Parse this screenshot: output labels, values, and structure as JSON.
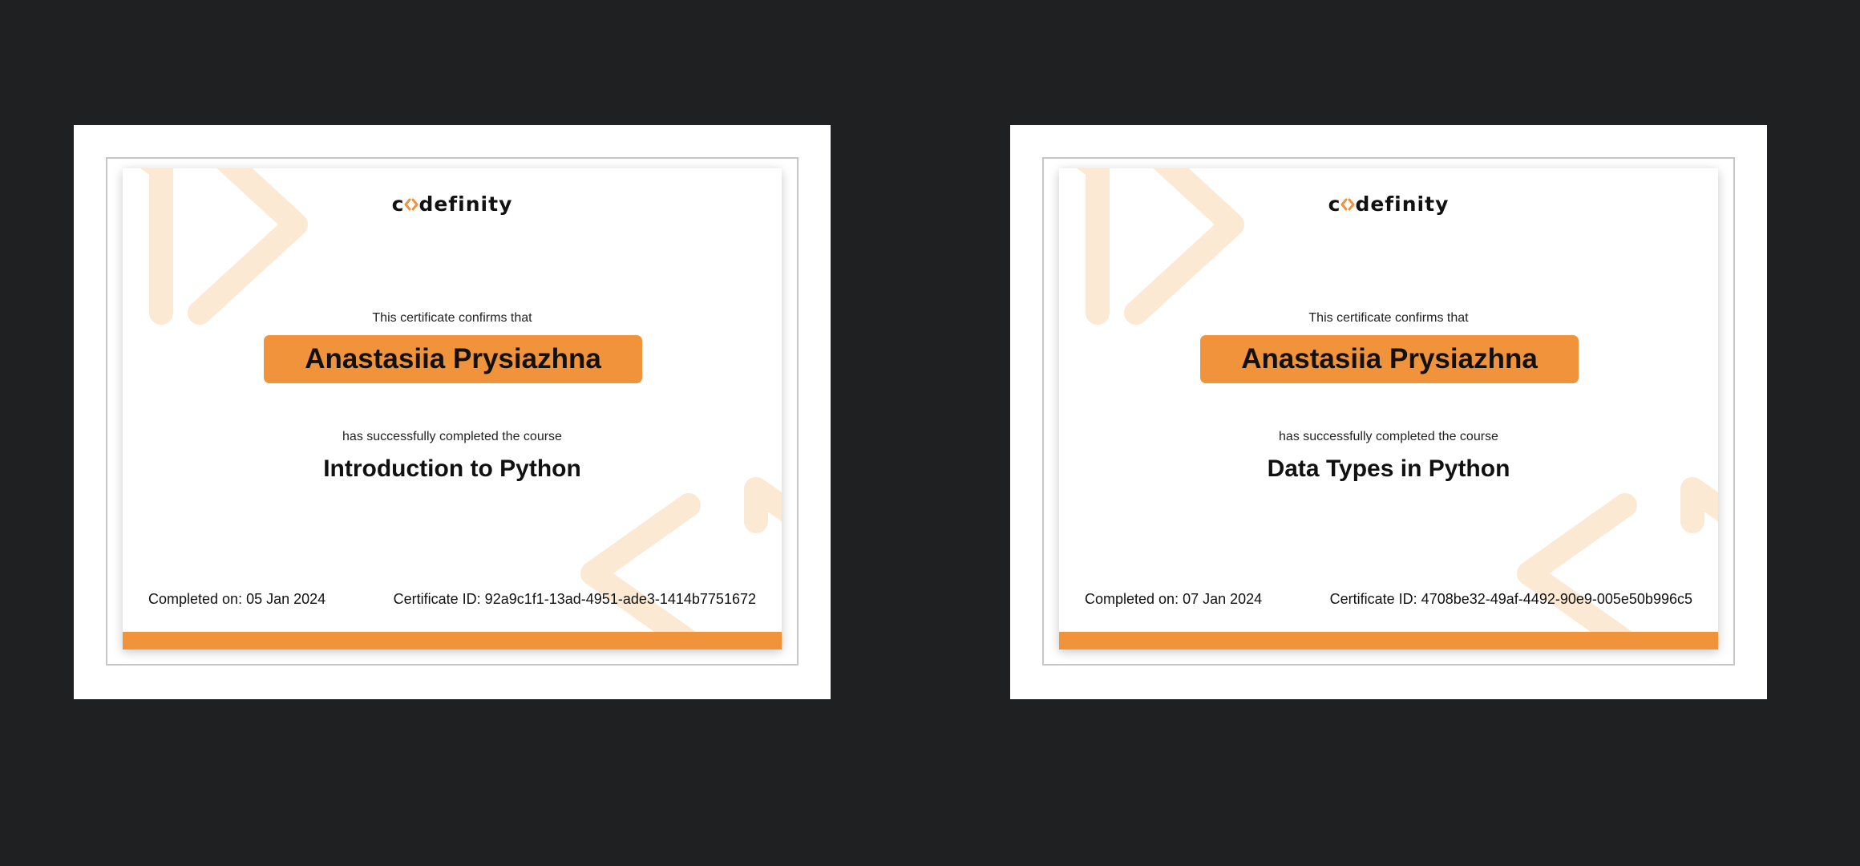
{
  "accent_color": "#f0933a",
  "background_color": "#1f2022",
  "certificates": [
    {
      "logo": {
        "before": "c",
        "after": "definity",
        "icon": "code-brackets-logo-icon"
      },
      "confirms_text": "This certificate confirms that",
      "recipient_name": "Anastasiia Prysiazhna",
      "completed_text": "has successfully completed the course",
      "course_title": "Introduction to Python",
      "completed_on": "Completed on: 05 Jan 2024",
      "certificate_id": "Certificate ID: 92a9c1f1-13ad-4951-ade3-1414b7751672"
    },
    {
      "logo": {
        "before": "c",
        "after": "definity",
        "icon": "code-brackets-logo-icon"
      },
      "confirms_text": "This certificate confirms that",
      "recipient_name": "Anastasiia Prysiazhna",
      "completed_text": "has successfully completed the course",
      "course_title": "Data Types in Python",
      "completed_on": "Completed on: 07 Jan 2024",
      "certificate_id": "Certificate ID: 4708be32-49af-4492-90e9-005e50b996c5"
    }
  ]
}
